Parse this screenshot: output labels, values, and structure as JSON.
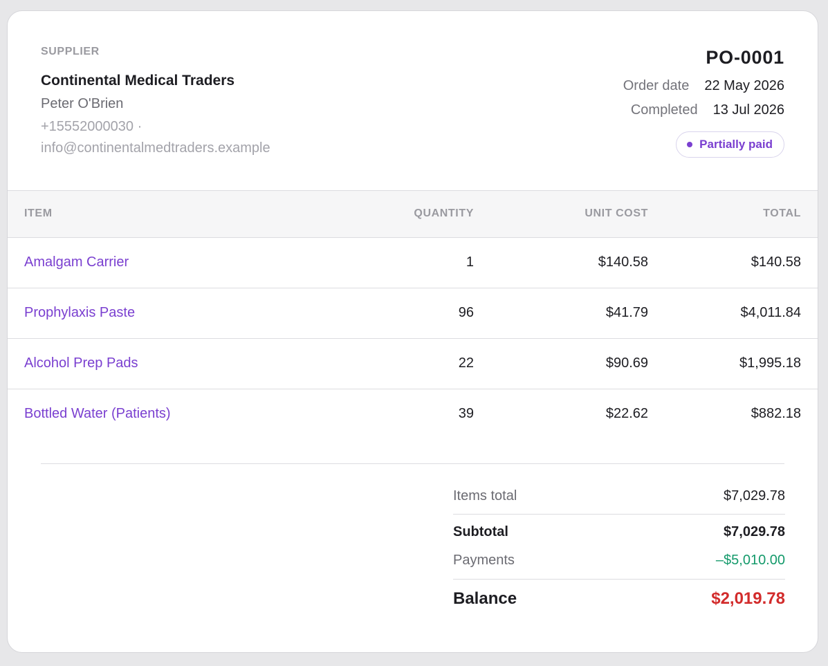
{
  "supplier": {
    "label": "SUPPLIER",
    "name": "Continental Medical Traders",
    "contact": "Peter O'Brien",
    "phone": "+15552000030 ·",
    "email": "info@continentalmedtraders.example"
  },
  "order": {
    "number": "PO-0001",
    "order_date_label": "Order date",
    "order_date": "22 May 2026",
    "completed_label": "Completed",
    "completed_date": "13 Jul 2026",
    "status": "Partially paid"
  },
  "table": {
    "headers": {
      "item": "ITEM",
      "quantity": "QUANTITY",
      "unit_cost": "UNIT COST",
      "total": "TOTAL"
    },
    "rows": [
      {
        "item": "Amalgam Carrier",
        "quantity": "1",
        "unit_cost": "$140.58",
        "total": "$140.58"
      },
      {
        "item": "Prophylaxis Paste",
        "quantity": "96",
        "unit_cost": "$41.79",
        "total": "$4,011.84"
      },
      {
        "item": "Alcohol Prep Pads",
        "quantity": "22",
        "unit_cost": "$90.69",
        "total": "$1,995.18"
      },
      {
        "item": "Bottled Water (Patients)",
        "quantity": "39",
        "unit_cost": "$22.62",
        "total": "$882.18"
      }
    ]
  },
  "totals": {
    "items_total_label": "Items total",
    "items_total": "$7,029.78",
    "subtotal_label": "Subtotal",
    "subtotal": "$7,029.78",
    "payments_label": "Payments",
    "payments": "–$5,010.00",
    "balance_label": "Balance",
    "balance": "$2,019.78"
  },
  "colors": {
    "accent": "#7a3fd0",
    "payments": "#149a6b",
    "balance": "#d22b2b"
  }
}
